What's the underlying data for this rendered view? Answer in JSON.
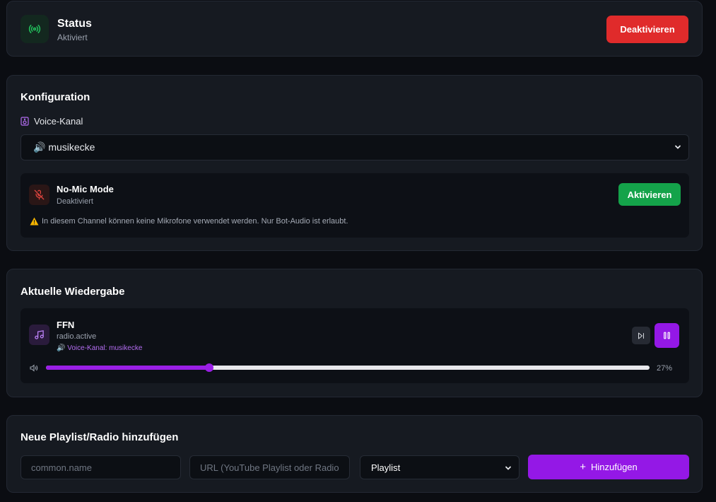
{
  "status": {
    "title": "Status",
    "state": "Aktiviert",
    "deactivate_label": "Deaktivieren",
    "icon": "broadcast-icon",
    "accent_color": "#22c55e",
    "button_color": "#e02b2b"
  },
  "config": {
    "title": "Konfiguration",
    "voice_label": "Voice-Kanal",
    "voice_selected": "🔊 musikecke",
    "nomic": {
      "title": "No-Mic Mode",
      "state": "Deaktiviert",
      "activate_label": "Aktivieren",
      "warning": "In diesem Channel können keine Mikrofone verwendet werden. Nur Bot-Audio ist erlaubt.",
      "icon": "mic-off-icon"
    }
  },
  "playing": {
    "title": "Aktuelle Wiedergabe",
    "track": "FFN",
    "source": "radio.active",
    "channel": "🔊 Voice-Kanal: musikecke",
    "volume_percent": 27,
    "volume_label": "27%",
    "accent_color": "#9418e6"
  },
  "add": {
    "title": "Neue Playlist/Radio hinzufügen",
    "name_placeholder": "common.name",
    "url_placeholder": "URL (YouTube Playlist oder Radio",
    "type_selected": "Playlist",
    "add_label": "Hinzufügen"
  }
}
